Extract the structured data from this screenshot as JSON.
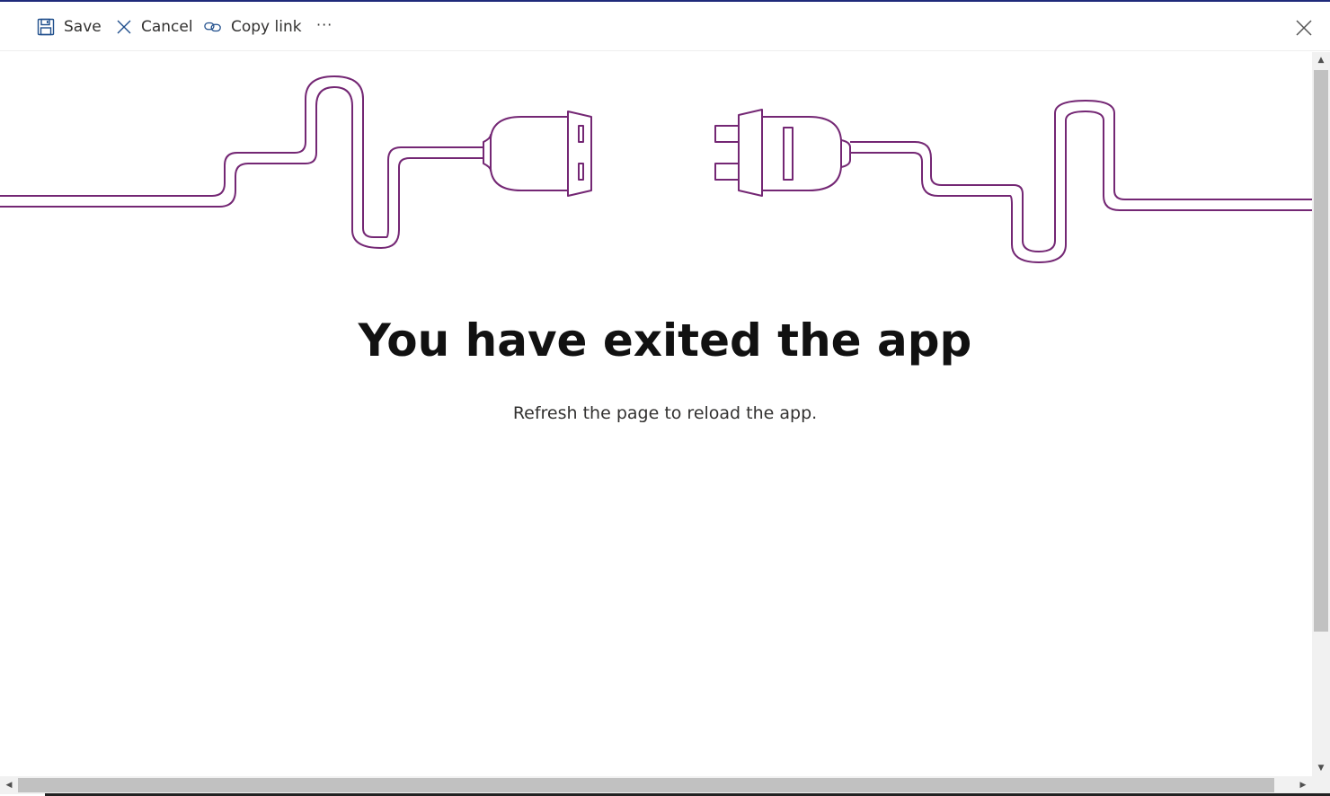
{
  "toolbar": {
    "save_label": "Save",
    "cancel_label": "Cancel",
    "copy_link_label": "Copy link",
    "more_label": "···"
  },
  "main": {
    "headline": "You have exited the app",
    "subtext": "Refresh the page to reload the app."
  },
  "icons": {
    "save": "save-icon",
    "cancel": "close-icon",
    "copy_link": "link-icon",
    "more": "more-icon",
    "close": "close-icon",
    "illustration": "unplugged-cable-illustration"
  },
  "colors": {
    "accent": "#1f2a7a",
    "illustration_stroke": "#742774",
    "icon_blue": "#1f4e8c"
  }
}
